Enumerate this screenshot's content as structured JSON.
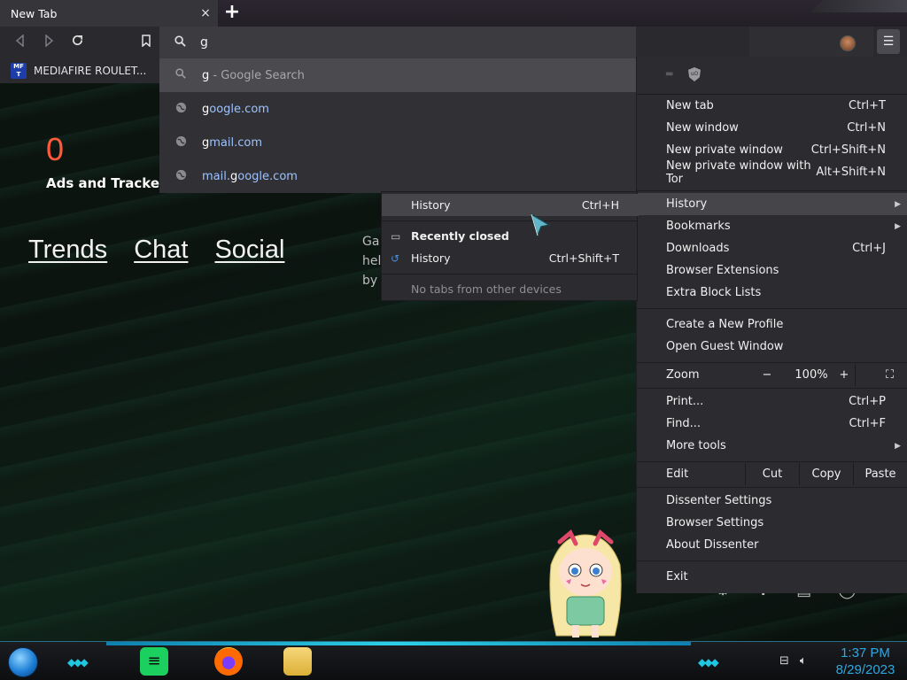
{
  "tab": {
    "title": "New Tab",
    "close_glyph": "×",
    "new_tab_glyph": "+"
  },
  "toolbar": {
    "back_icon": "back-arrow-icon",
    "forward_icon": "forward-arrow-icon",
    "reload_icon": "reload-icon",
    "bookmark_icon": "bookmark-icon",
    "omnibox_value": "g",
    "menu_icon": "hamburger-icon"
  },
  "bookmarks": [
    {
      "icon_text": "MF T",
      "label": "MEDIAFIRE ROULET..."
    }
  ],
  "suggestions": [
    {
      "icon": "search-icon",
      "bold": "g",
      "rest": " - Google Search",
      "selected": true
    },
    {
      "icon": "globe-icon",
      "bold": "g",
      "rest": "oogle.com"
    },
    {
      "icon": "globe-icon",
      "bold": "g",
      "rest": "mail.com"
    },
    {
      "icon": "globe-icon",
      "pre": "mail.",
      "bold": "g",
      "rest": "oogle.com"
    }
  ],
  "page": {
    "counter_value": "0",
    "counter_label": "Ads and Trackers",
    "links": [
      "Trends",
      "Chat",
      "Social"
    ],
    "side_text_lines": [
      "Ga",
      "hel",
      "by"
    ]
  },
  "menu": {
    "items": [
      {
        "label": "New tab",
        "shortcut": "Ctrl+T"
      },
      {
        "label": "New window",
        "shortcut": "Ctrl+N"
      },
      {
        "label": "New private window",
        "shortcut": "Ctrl+Shift+N"
      },
      {
        "label": "New private window with Tor",
        "shortcut": "Alt+Shift+N"
      },
      {
        "label": "History",
        "shortcut": "",
        "submenu": true,
        "highlighted": true
      },
      {
        "label": "Bookmarks",
        "shortcut": "",
        "submenu": true
      },
      {
        "label": "Downloads",
        "shortcut": "Ctrl+J"
      },
      {
        "label": "Browser Extensions",
        "shortcut": ""
      },
      {
        "label": "Extra Block Lists",
        "shortcut": ""
      },
      {
        "label": "Create a New Profile",
        "shortcut": ""
      },
      {
        "label": "Open Guest Window",
        "shortcut": ""
      },
      {
        "label": "Zoom",
        "shortcut": ""
      },
      {
        "label": "Print...",
        "shortcut": "Ctrl+P"
      },
      {
        "label": "Find...",
        "shortcut": "Ctrl+F"
      },
      {
        "label": "More tools",
        "shortcut": "",
        "submenu": true
      },
      {
        "label": "Edit",
        "shortcut": ""
      },
      {
        "label": "Dissenter Settings",
        "shortcut": ""
      },
      {
        "label": "Browser Settings",
        "shortcut": ""
      },
      {
        "label": "About Dissenter",
        "shortcut": ""
      },
      {
        "label": "Exit",
        "shortcut": ""
      }
    ],
    "zoom": {
      "minus": "−",
      "level": "100%",
      "plus": "+",
      "fullscreen_icon": "fullscreen-icon"
    },
    "edit": {
      "cut": "Cut",
      "copy": "Copy",
      "paste": "Paste"
    }
  },
  "history_menu": {
    "history_label": "History",
    "history_shortcut": "Ctrl+H",
    "recently_closed": "Recently closed",
    "history2_label": "History",
    "history2_shortcut": "Ctrl+Shift+T",
    "no_tabs": "No tabs from other devices"
  },
  "taskbar": {
    "time": "1:37 PM",
    "date": "8/29/2023",
    "apps": [
      "spotify-icon",
      "firefox-icon",
      "file-explorer-icon"
    ]
  },
  "colors": {
    "accent": "#2fa8e0",
    "counter": "#ff5a3c",
    "link": "#9ec3ff",
    "menu_bg": "#2c2c30"
  }
}
